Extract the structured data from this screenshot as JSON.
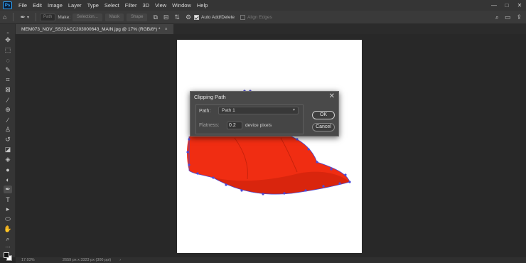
{
  "menu": [
    "File",
    "Edit",
    "Image",
    "Layer",
    "Type",
    "Select",
    "Filter",
    "3D",
    "View",
    "Window",
    "Help"
  ],
  "app_logo": "Ps",
  "window_controls": [
    "—",
    "□",
    "✕"
  ],
  "options_bar": {
    "path_mode": "Path",
    "make_label": "Make:",
    "selection_btn": "Selection...",
    "mask_btn": "Mask",
    "shape_btn": "Shape",
    "auto_add_delete": "Auto Add/Delete",
    "auto_add_delete_checked": true,
    "align_edges": "Align Edges",
    "align_edges_checked": false
  },
  "document_tab": {
    "title": "MEM073_NOV_SS22ACC203000643_MAIN.jpg @ 17% (RGB/8*) *",
    "close": "×"
  },
  "status_bar": {
    "zoom": "17.03%",
    "info": "2659 px x 3323 px (300 ppi)",
    "arrow": "›"
  },
  "dialog": {
    "title": "Clipping Path",
    "close": "✕",
    "path_label": "Path:",
    "path_value": "Path 1",
    "flatness_label": "Flatness:",
    "flatness_value": "0.2",
    "flatness_units": "device pixels",
    "ok_label": "OK",
    "cancel_label": "Cancel"
  },
  "colors": {
    "cap_red": "#f02d12",
    "path_anchor": "#4a4ad8",
    "canvas_bg": "#282828",
    "ui_panel": "#353535"
  }
}
